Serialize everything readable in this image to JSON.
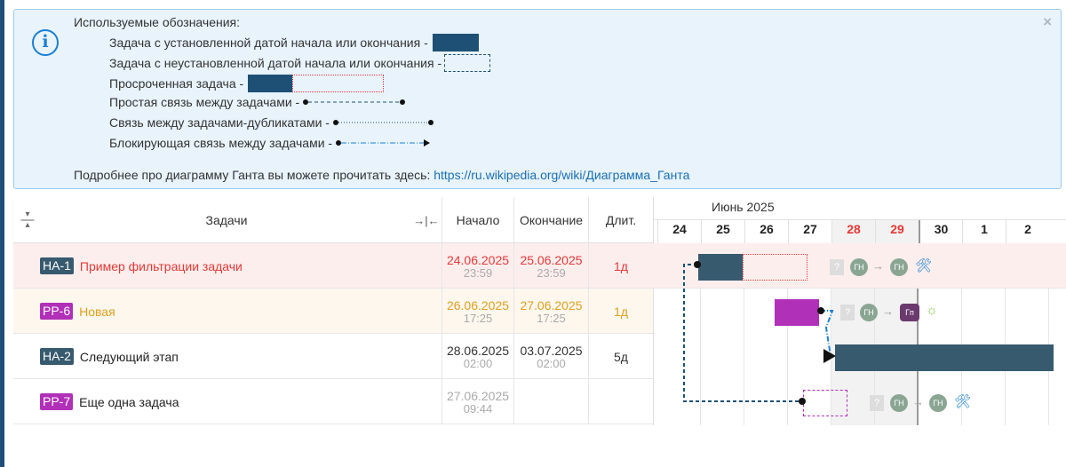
{
  "legend": {
    "title": "Используемые обозначения:",
    "items": [
      "Задача с установленной датой начала или окончания -",
      "Задача с неустановленной датой начала или окончания -",
      "Просроченная задача -",
      "Простая связь между задачами -",
      "Связь между задачами-дубликатами -",
      "Блокирующая связь между задачами -"
    ],
    "more_text": "Подробнее про диаграмму Ганта вы можете прочитать здесь:",
    "more_link": "https://ru.wikipedia.org/wiki/Диаграмма_Ганта",
    "close": "×"
  },
  "columns": {
    "tasks": "Задачи",
    "start": "Начало",
    "end": "Окончание",
    "duration": "Длит."
  },
  "gantt": {
    "month": "Июнь 2025",
    "days": [
      "24",
      "25",
      "26",
      "27",
      "28",
      "29",
      "30",
      "1",
      "2"
    ]
  },
  "rows": [
    {
      "key": "HA-1",
      "title": "Пример фильтрации задачи",
      "start_date": "24.06.2025",
      "start_time": "23:59",
      "end_date": "25.06.2025",
      "end_time": "23:59",
      "duration": "1д"
    },
    {
      "key": "PP-6",
      "title": "Новая",
      "start_date": "26.06.2025",
      "start_time": "17:25",
      "end_date": "27.06.2025",
      "end_time": "17:25",
      "duration": "1д"
    },
    {
      "key": "HA-2",
      "title": "Следующий этап",
      "start_date": "28.06.2025",
      "start_time": "02:00",
      "end_date": "03.07.2025",
      "end_time": "02:00",
      "duration": "5д"
    },
    {
      "key": "PP-7",
      "title": "Еще одна задача",
      "start_date": "27.06.2025",
      "start_time": "09:44",
      "end_date": "",
      "end_time": "",
      "duration": ""
    }
  ],
  "avatars": {
    "a": "ГН",
    "b": "Гп",
    "unknown": "?"
  },
  "colors": {
    "task_dark": "#375a6e",
    "project_purple": "#b130b8",
    "overdue_red": "#e53935",
    "warn_orange": "#e0a020",
    "weekend_red": "#e53935",
    "info_bg": "#e8f3fc"
  }
}
